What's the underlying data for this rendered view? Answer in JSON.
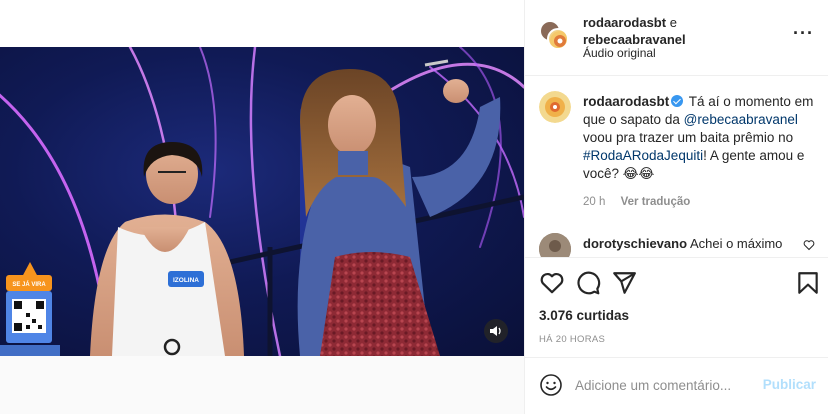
{
  "post": {
    "header": {
      "author1": "rodaarodasbt",
      "conjunction": "e",
      "author2": "rebecaabravanel",
      "audio": "Áudio original",
      "more_icon": "more-horizontal-icon"
    },
    "caption": {
      "username": "rodaarodasbt",
      "text_before_mention": "Tá aí o momento em que o sapato da",
      "mention": "@rebecaabravanel",
      "text_after_mention": "voou pra trazer um baita prêmio no",
      "hashtag": "#RodaARodaJequiti",
      "text_end": "! A gente amou e você? 😂😂",
      "time": "20 h",
      "translate": "Ver tradução"
    },
    "comment": {
      "username": "dorotyschievano",
      "text": "Achei o máximo"
    },
    "video": {
      "contestant_name_tag": "IZOLINA",
      "qr_badge": "SE JÁ VIRA"
    },
    "actions": {
      "likes": "3.076 curtidas",
      "time_ago": "HÁ 20 HORAS"
    },
    "comment_input": {
      "placeholder": "Adicione um comentário...",
      "publish": "Publicar"
    },
    "colors": {
      "link": "#00376b",
      "verified": "#3897f0",
      "publish_disabled": "#b2dffc",
      "muted_text": "#8e8e8e"
    }
  }
}
